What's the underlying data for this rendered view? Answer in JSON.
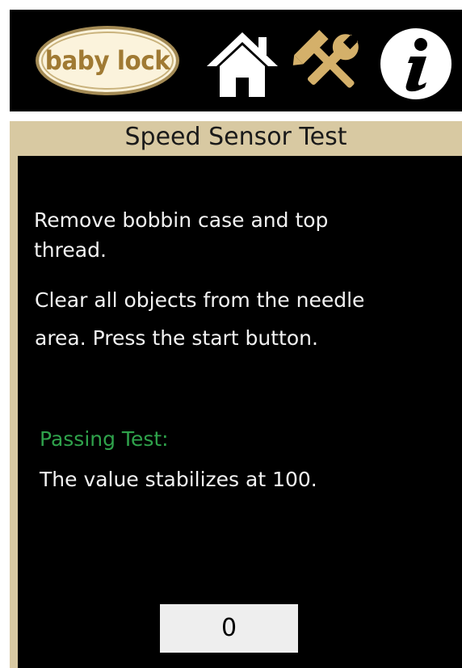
{
  "header": {
    "logo_text": "baby lock",
    "icons": {
      "home": "home-icon",
      "tools": "tools-icon",
      "info": "info-icon"
    }
  },
  "test": {
    "title": "Speed Sensor Test",
    "instruction_1": "Remove bobbin case and top thread.",
    "instruction_2": "Clear all objects from the needle area. Press the start button.",
    "passing_label": "Passing Test:",
    "passing_criteria": "The value stabilizes at 100.",
    "value": "0"
  },
  "colors": {
    "header_bg": "#000000",
    "panel_tan": "#d8c9a2",
    "passing_green": "#2fa24b",
    "logo_gold": "#a07a33",
    "tools_gold": "#d4b06a"
  }
}
